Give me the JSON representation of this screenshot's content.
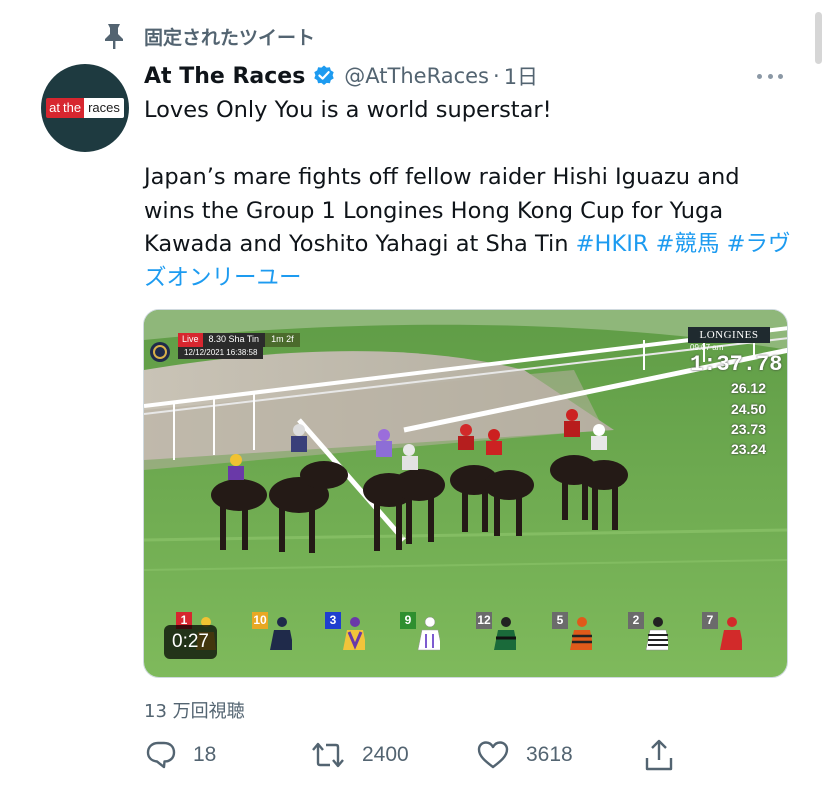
{
  "pinned": {
    "label": "固定されたツイート",
    "icon": "pin-icon"
  },
  "author": {
    "avatar_logo": {
      "at": "at",
      "the": "the",
      "races": "races"
    },
    "display_name": "At The Races",
    "verified_icon": "verified-badge-icon",
    "handle": "@AtTheRaces",
    "separator": "·",
    "time": "1日"
  },
  "tweet": {
    "line1": "Loves Only You is a world superstar!",
    "body": "Japan’s mare fights off fellow raider Hishi Iguazu and wins the Group 1 Longines Hong Kong Cup for Yuga Kawada and Yoshito Yahagi at Sha Tin ",
    "hashtags": [
      "#HKIR",
      "#競馬",
      "#ラヴズオンリーユー"
    ]
  },
  "media": {
    "duration": "0:27",
    "overlay": {
      "live": "Live",
      "venue": "8.30 Sha Tin",
      "distance": "1m 2f",
      "datetime": "12/12/2021 16:38:58",
      "brand": "LONGINES",
      "clock": "09:07 am",
      "timer": "1:37.78",
      "splits": [
        "26.12",
        "24.50",
        "23.73",
        "23.24"
      ]
    },
    "silks": [
      {
        "num": "1",
        "num_color": "#d7262f"
      },
      {
        "num": "10",
        "num_color": "#e8a823"
      },
      {
        "num": "3",
        "num_color": "#1f3fcf"
      },
      {
        "num": "9",
        "num_color": "#2f8f2f"
      },
      {
        "num": "12",
        "num_color": "#6b6b6b"
      },
      {
        "num": "5",
        "num_color": "#6b6b6b"
      },
      {
        "num": "2",
        "num_color": "#6b6b6b"
      },
      {
        "num": "7",
        "num_color": "#6b6b6b"
      }
    ]
  },
  "views": "13 万回視聴",
  "actions": {
    "reply": {
      "icon": "reply-icon",
      "count": "18"
    },
    "retweet": {
      "icon": "retweet-icon",
      "count": "2400"
    },
    "like": {
      "icon": "heart-icon",
      "count": "3618"
    },
    "share": {
      "icon": "share-icon"
    }
  },
  "colors": {
    "link": "#1d9bf0",
    "secondary_text": "#536471",
    "verified": "#1d9bf0"
  }
}
